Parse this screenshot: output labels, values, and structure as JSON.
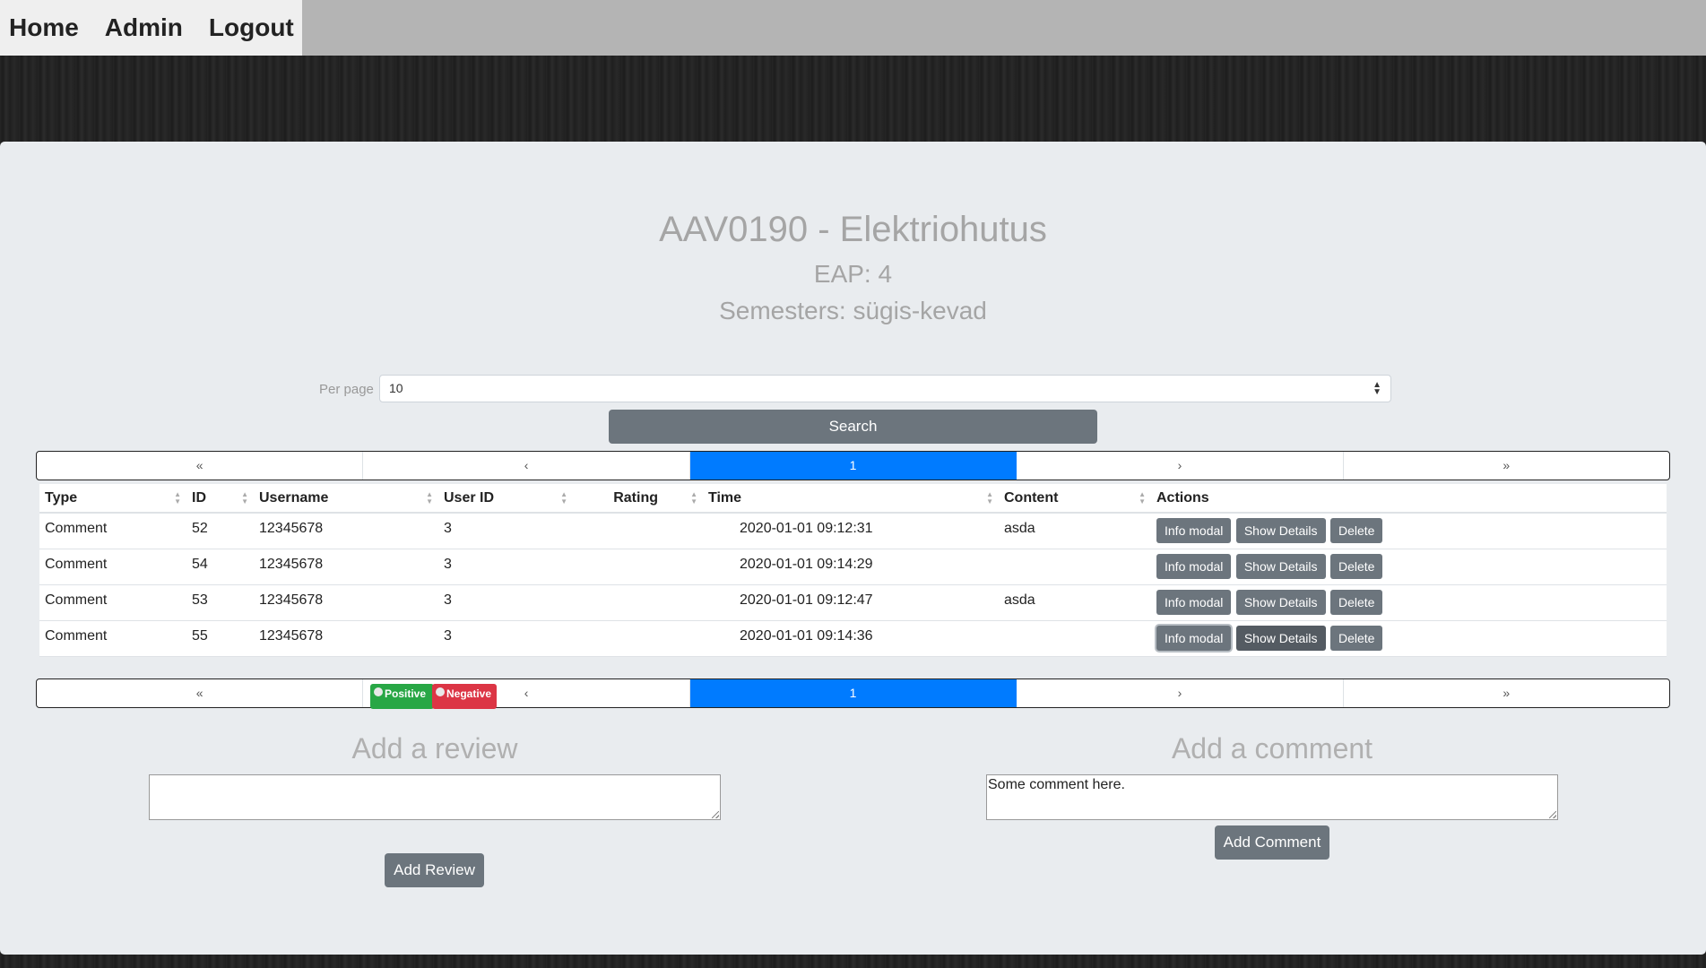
{
  "nav": {
    "links": [
      "Home",
      "Admin",
      "Logout"
    ]
  },
  "course": {
    "title": "AAV0190 - Elektriohutus",
    "eap": "EAP: 4",
    "semesters": "Semesters: sügis-kevad"
  },
  "filter": {
    "per_page_label": "Per page",
    "per_page_value": "10",
    "search_label": "Search"
  },
  "pagination": {
    "first": "«",
    "prev": "‹",
    "current": "1",
    "next": "›",
    "last": "»"
  },
  "table": {
    "columns": [
      "Type",
      "ID",
      "Username",
      "User ID",
      "Rating",
      "Time",
      "Content",
      "Actions"
    ],
    "rows": [
      {
        "type": "Comment",
        "id": "52",
        "username": "12345678",
        "user_id": "3",
        "rating": "",
        "time": "2020-01-01 09:12:31",
        "content": "asda"
      },
      {
        "type": "Comment",
        "id": "54",
        "username": "12345678",
        "user_id": "3",
        "rating": "",
        "time": "2020-01-01 09:14:29",
        "content": ""
      },
      {
        "type": "Comment",
        "id": "53",
        "username": "12345678",
        "user_id": "3",
        "rating": "",
        "time": "2020-01-01 09:12:47",
        "content": "asda"
      },
      {
        "type": "Comment",
        "id": "55",
        "username": "12345678",
        "user_id": "3",
        "rating": "",
        "time": "2020-01-01 09:14:36",
        "content": ""
      }
    ],
    "actions": {
      "info": "Info modal",
      "details": "Show Details",
      "delete": "Delete"
    }
  },
  "review": {
    "heading": "Add a review",
    "value": "",
    "positive": "Positive",
    "negative": "Negative",
    "submit": "Add Review"
  },
  "comment": {
    "heading": "Add a comment",
    "value": "Some comment here.",
    "submit": "Add Comment"
  },
  "colors": {
    "primary": "#007bff",
    "secondary": "#6c757d",
    "success": "#28a745",
    "danger": "#dc3545"
  }
}
